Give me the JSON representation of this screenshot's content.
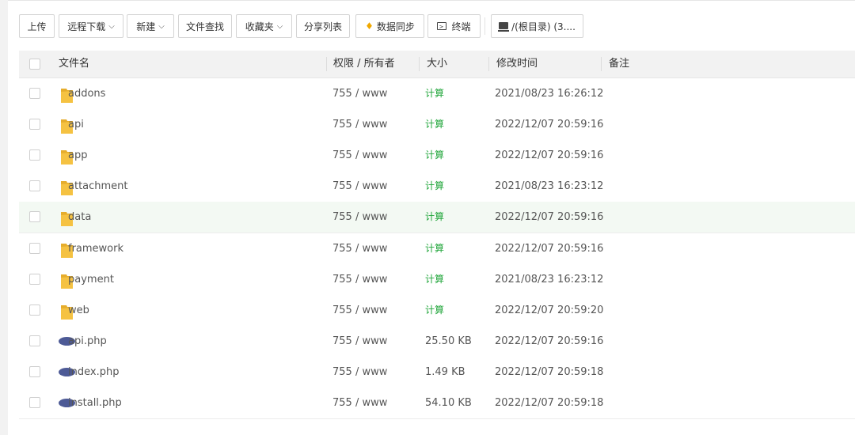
{
  "toolbar": {
    "buttons": [
      {
        "label": "上传"
      },
      {
        "label": "远程下载"
      },
      {
        "label": "新建"
      },
      {
        "label": "文件查找"
      },
      {
        "label": "收藏夹"
      },
      {
        "label": "分享列表"
      },
      {
        "label": "数据同步"
      },
      {
        "label": "终端"
      },
      {
        "label": "/(根目录) (3...."
      }
    ]
  },
  "table": {
    "headers": {
      "name": "文件名",
      "perm": "权限 / 所有者",
      "size": "大小",
      "mtime": "修改时间",
      "note": "备注"
    },
    "rows": [
      {
        "name": "addons",
        "type": "folder",
        "perm": "755 / www",
        "size": "计算",
        "mtime": "2021/08/23 16:26:12"
      },
      {
        "name": "api",
        "type": "folder",
        "perm": "755 / www",
        "size": "计算",
        "mtime": "2022/12/07 20:59:16"
      },
      {
        "name": "app",
        "type": "folder",
        "perm": "755 / www",
        "size": "计算",
        "mtime": "2022/12/07 20:59:16"
      },
      {
        "name": "attachment",
        "type": "folder",
        "perm": "755 / www",
        "size": "计算",
        "mtime": "2021/08/23 16:23:12"
      },
      {
        "name": "data",
        "type": "folder",
        "perm": "755 / www",
        "size": "计算",
        "mtime": "2022/12/07 20:59:16"
      },
      {
        "name": "framework",
        "type": "folder",
        "perm": "755 / www",
        "size": "计算",
        "mtime": "2022/12/07 20:59:16"
      },
      {
        "name": "payment",
        "type": "folder",
        "perm": "755 / www",
        "size": "计算",
        "mtime": "2021/08/23 16:23:12"
      },
      {
        "name": "web",
        "type": "folder",
        "perm": "755 / www",
        "size": "计算",
        "mtime": "2022/12/07 20:59:20"
      },
      {
        "name": "api.php",
        "type": "php",
        "perm": "755 / www",
        "size": "25.50 KB",
        "mtime": "2022/12/07 20:59:16"
      },
      {
        "name": "index.php",
        "type": "php",
        "perm": "755 / www",
        "size": "1.49 KB",
        "mtime": "2022/12/07 20:59:18"
      },
      {
        "name": "install.php",
        "type": "php",
        "perm": "755 / www",
        "size": "54.10 KB",
        "mtime": "2022/12/07 20:59:18"
      }
    ]
  },
  "icons": {
    "folder": "folder-icon",
    "php": "php-file-icon",
    "sync": "diamond-icon",
    "terminal": "terminal-icon",
    "drive": "drive-icon"
  },
  "colors": {
    "calc_link": "#20a53a",
    "folder": "#f5c242",
    "php_badge": "#4d5a96",
    "hover_row": "#f3f9f3"
  }
}
